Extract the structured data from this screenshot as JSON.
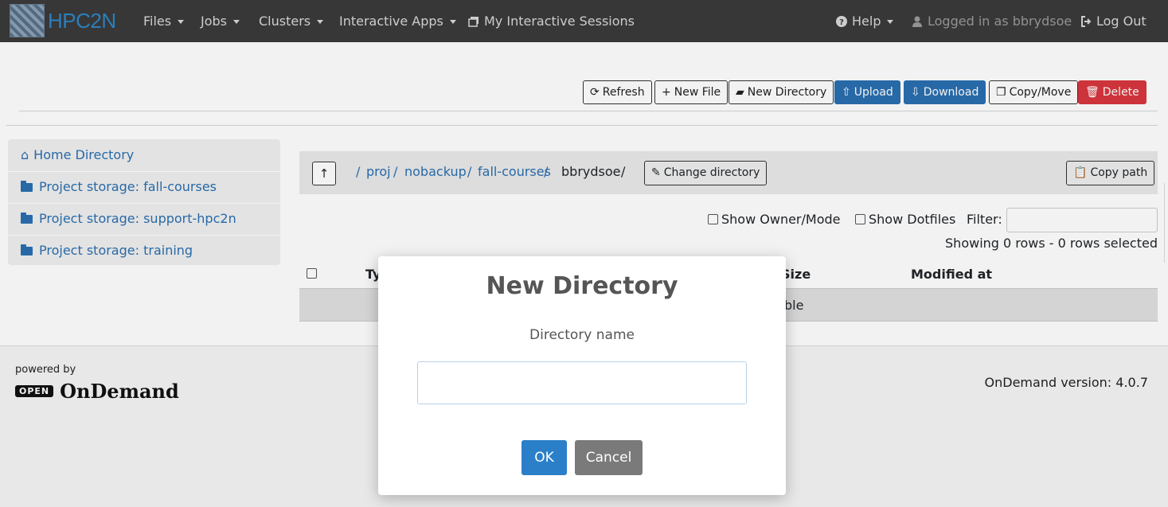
{
  "app": {
    "brand_text": "HPC2N"
  },
  "navbar": {
    "files": "Files",
    "jobs": "Jobs",
    "clusters": "Clusters",
    "interactive_apps": "Interactive Apps",
    "sessions": "My Interactive Sessions",
    "help": "Help",
    "logged_in": "Logged in as bbrydsoe",
    "logout": "Log Out"
  },
  "toolbar": {
    "refresh": "Refresh",
    "new_file": "New File",
    "new_directory": "New Directory",
    "upload": "Upload",
    "download": "Download",
    "copy_move": "Copy/Move",
    "delete": "Delete"
  },
  "sidebar": {
    "items": [
      {
        "label": "Home Directory",
        "icon": "home-icon"
      },
      {
        "label": "Project storage: fall-courses",
        "icon": "folder-icon"
      },
      {
        "label": "Project storage: support-hpc2n",
        "icon": "folder-icon"
      },
      {
        "label": "Project storage: training",
        "icon": "folder-icon"
      }
    ]
  },
  "pathbar": {
    "crumbs": [
      "proj",
      "nobackup",
      "fall-courses",
      "bbrydsoe"
    ],
    "separator": "/",
    "change_directory": "Change directory",
    "copy_path": "Copy path"
  },
  "options": {
    "show_owner": "Show Owner/Mode",
    "show_dotfiles": "Show Dotfiles",
    "filter_label": "Filter:",
    "filter_value": "",
    "rows_info": "Showing 0 rows - 0 rows selected"
  },
  "table": {
    "col_type_partial": "Ty",
    "col_size_partial": "Size",
    "col_modified": "Modified at",
    "row_text_partial": "ble"
  },
  "footer": {
    "powered_by": "powered by",
    "logo_open": "OPEN",
    "logo_ondemand": "OnDemand",
    "version": "OnDemand version: 4.0.7"
  },
  "modal": {
    "title": "New Directory",
    "label": "Directory name",
    "input_value": "",
    "ok": "OK",
    "cancel": "Cancel"
  },
  "colors": {
    "navbar_bg": "#3a3a3a",
    "primary": "#2a6fb0",
    "danger": "#d9363e",
    "ok_button": "#2a7fc8",
    "cancel_button": "#7a7a7a"
  }
}
